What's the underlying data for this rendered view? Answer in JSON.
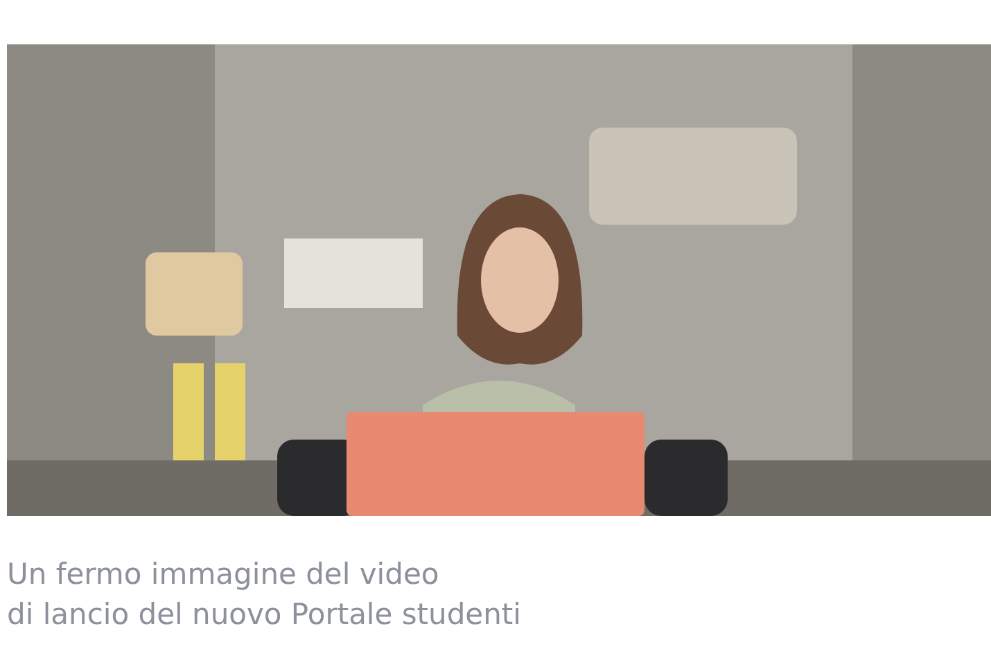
{
  "caption": {
    "lines": [
      "Un fermo immagine del video",
      "di lancio del nuovo Portale studenti"
    ]
  }
}
